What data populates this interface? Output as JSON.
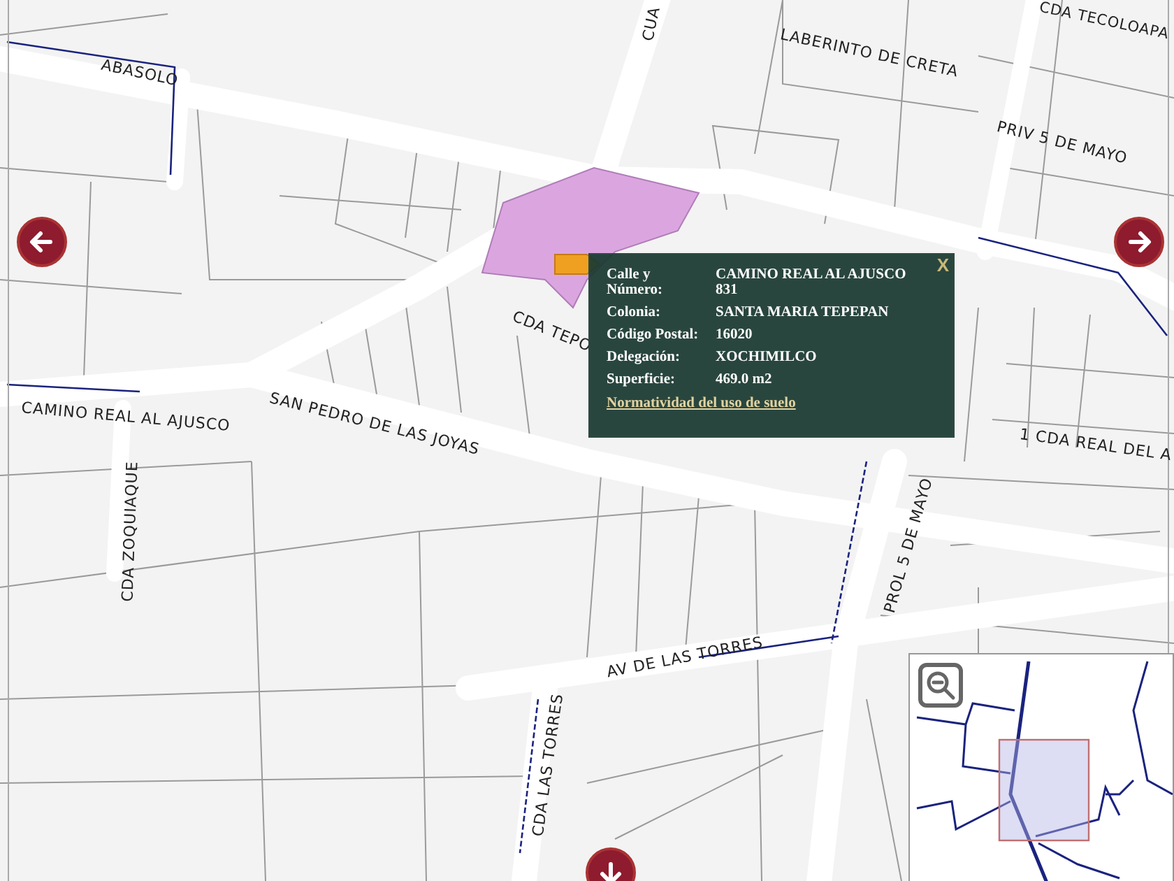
{
  "map": {
    "street_labels": [
      "ABASOLO",
      "CUA",
      "LABERINTO DE CRETA",
      "CDA TECOLOAPA",
      "PRIV 5 DE MAYO",
      "CDA TEPO",
      "CAMINO REAL AL AJUSCO",
      "SAN PEDRO DE LAS JOYAS",
      "CDA ZOQUIAQUE",
      "1 CDA REAL DEL A",
      "PROL 5 DE MAYO",
      "AV DE LAS TORRES",
      "CDA LAS TORRES"
    ]
  },
  "popup": {
    "close": "X",
    "fields": [
      {
        "label": "Calle y Número:",
        "value": "CAMINO REAL AL AJUSCO 831"
      },
      {
        "label": "Colonia:",
        "value": "SANTA MARIA TEPEPAN"
      },
      {
        "label": "Código Postal:",
        "value": "16020"
      },
      {
        "label": "Delegación:",
        "value": "XOCHIMILCO"
      },
      {
        "label": "Superficie:",
        "value": "469.0 m2"
      }
    ],
    "link": "Normatividad del uso de suelo"
  }
}
